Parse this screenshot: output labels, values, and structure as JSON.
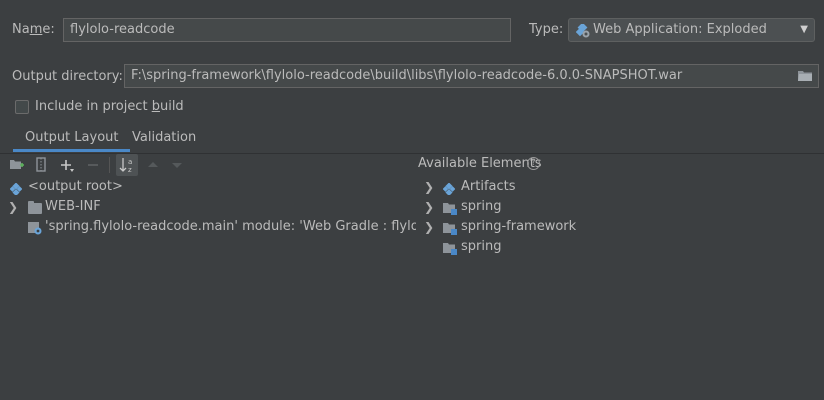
{
  "form": {
    "name_label_pre": "Na",
    "name_label_underline": "m",
    "name_label_post": "e:",
    "name_value": "flylolo-readcode",
    "type_label": "Type:",
    "type_value": "Web Application: Exploded",
    "output_dir_label": "Output directory:",
    "output_dir_value": "F:\\spring-framework\\flylolo-readcode\\build\\libs\\flylolo-readcode-6.0.0-SNAPSHOT.war",
    "include_label_pre": "Include in project ",
    "include_label_underline": "b",
    "include_label_post": "uild",
    "include_checked": false
  },
  "tabs": [
    {
      "label": "Output Layout",
      "active": true
    },
    {
      "label": "Validation",
      "active": false
    }
  ],
  "left_tree": [
    {
      "label": "<output root>",
      "icon": "output-root-icon",
      "expandable": false
    },
    {
      "label": "WEB-INF",
      "icon": "folder-icon",
      "expandable": true
    },
    {
      "label": "'spring.flylolo-readcode.main' module: 'Web Gradle : flylolo-rea",
      "icon": "module-icon",
      "expandable": false
    }
  ],
  "available": {
    "header": "Available Elements",
    "items": [
      {
        "label": "Artifacts",
        "icon": "artifacts-icon",
        "expandable": true
      },
      {
        "label": "spring",
        "icon": "module-folder-icon",
        "expandable": true
      },
      {
        "label": "spring-framework",
        "icon": "module-folder-icon",
        "expandable": true
      },
      {
        "label": "spring",
        "icon": "module-folder-icon",
        "expandable": false
      }
    ]
  },
  "colors": {
    "background": "#3c3f41",
    "accent": "#4a88c7",
    "text": "#bbbbbb"
  }
}
